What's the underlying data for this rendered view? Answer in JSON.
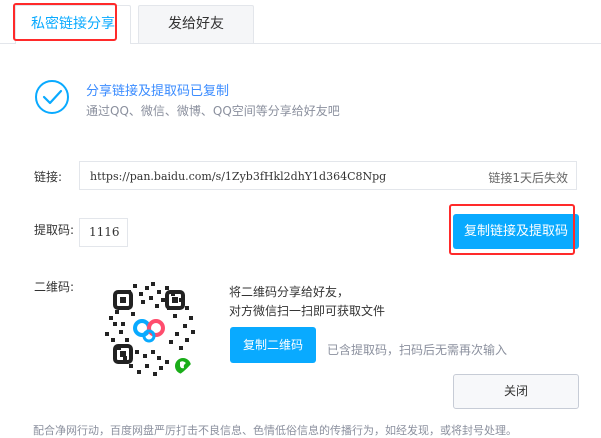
{
  "tabs": [
    {
      "label": "私密链接分享",
      "active": true
    },
    {
      "label": "发给好友",
      "active": false
    }
  ],
  "success": {
    "title": "分享链接及提取码已复制",
    "subtitle": "通过QQ、微信、微博、QQ空间等分享给好友吧"
  },
  "link": {
    "label": "链接:",
    "url": "https://pan.baidu.com/s/1Zyb3fHkl2dhY1d364C8Npg",
    "expire": "链接1天后失效"
  },
  "code": {
    "label": "提取码:",
    "value": "1116"
  },
  "copy_button": "复制链接及提取码",
  "qr": {
    "label": "二维码:",
    "line1": "将二维码分享给好友，",
    "line2": "对方微信扫一扫即可获取文件",
    "button": "复制二维码",
    "note": "已含提取码，扫码后无需再次输入"
  },
  "close_button": "关闭",
  "footer": "配合净网行动，百度网盘严厉打击不良信息、色情低俗信息的传播行为，如经发现，或将封号处理。",
  "colors": {
    "accent": "#09aaff",
    "highlight": "#ff2a2a",
    "muted": "#8b909e"
  }
}
